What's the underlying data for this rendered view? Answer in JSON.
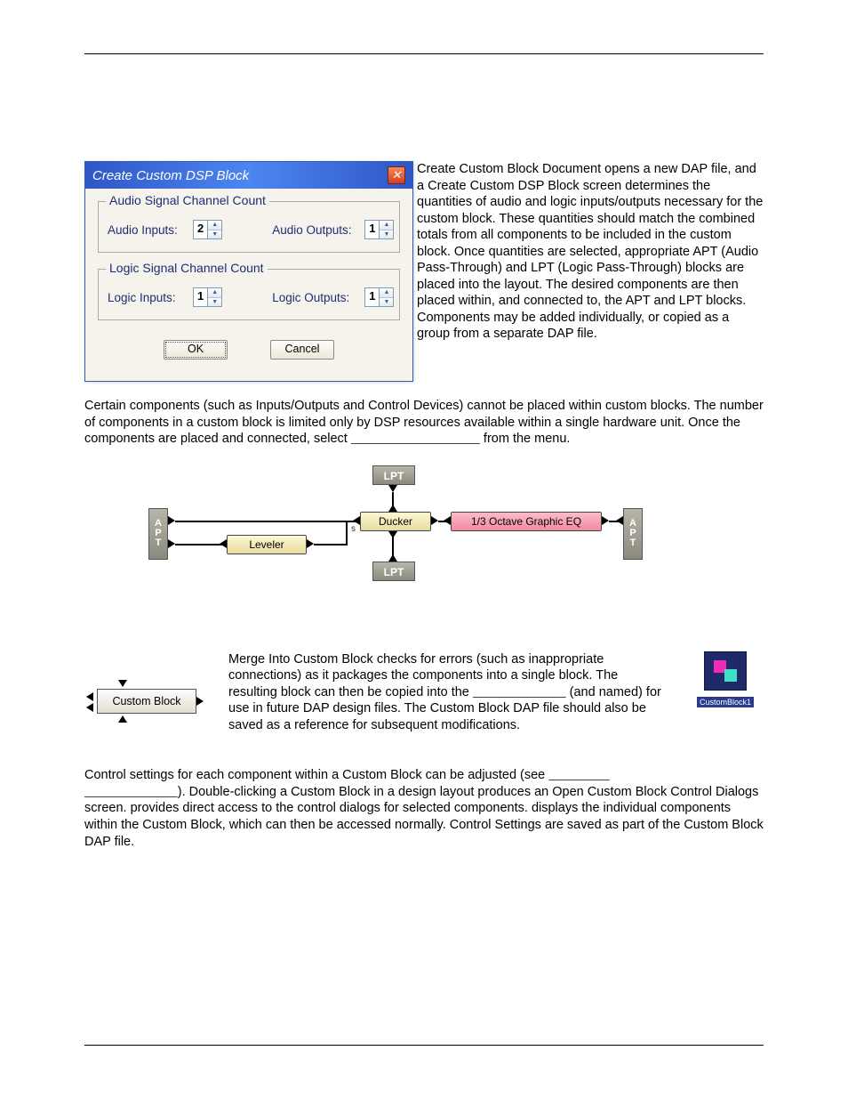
{
  "dialog": {
    "title": "Create Custom DSP Block",
    "close": "✕",
    "audio_legend": "Audio Signal Channel Count",
    "logic_legend": "Logic Signal Channel Count",
    "audio_inputs_label": "Audio Inputs:",
    "audio_inputs_value": "2",
    "audio_outputs_label": "Audio Outputs:",
    "audio_outputs_value": "1",
    "logic_inputs_label": "Logic Inputs:",
    "logic_inputs_value": "1",
    "logic_outputs_label": "Logic Outputs:",
    "logic_outputs_value": "1",
    "ok": "OK",
    "cancel": "Cancel"
  },
  "para1": "Create Custom Block Document opens a new DAP file, and a Create Custom DSP Block screen determines the quantities of audio and logic inputs/outputs necessary for the custom block. These quantities should match the combined totals from all components to be included in the custom block. Once quantities are selected, appropriate APT (Audio Pass-Through) and LPT (Logic Pass-Through) blocks are placed into the layout. The desired components are then placed within, and connected to, the APT and LPT blocks. Components may be added individually, or copied as a group from a separate DAP file.",
  "para2a": "Certain components (such as Inputs/Outputs and Control Devices) cannot be placed within custom blocks. The number of components in a custom block is limited only by DSP resources available within a single hardware unit. Once the components are placed and connected, select ",
  "para2b": " from the menu.",
  "diagram": {
    "lpt": "LPT",
    "apt": "A\nP\nT",
    "leveler": "Leveler",
    "ducker": "Ducker",
    "eq": "1/3 Octave Graphic EQ",
    "s": "s"
  },
  "custom_block_label": "Custom Block",
  "para3a": "Merge Into Custom Block checks for errors (such as inappropriate connections) as it packages the components into a single block. The resulting block can then be copied into the ",
  "para3b": " (and named) for use in future DAP design files. The Custom Block DAP file should also be saved as a reference for subsequent modifications.",
  "icon_caption": "CustomBlock1",
  "para4a": "Control settings for each component within a Custom Block can be adjusted (see ",
  "para4b": "). Double-clicking a Custom Block in a design layout produces an Open Custom Block Control Dialogs screen. ",
  "para4_bold1": "",
  "para4c": " provides direct access to the control dialogs for selected components. ",
  "para4_bold2": "",
  "para4d": " displays the individual components within the Custom Block, which can then be accessed normally. Control Settings are saved as part of the Custom Block DAP file.",
  "blank_long": "                                    ",
  "blank_med": "                          ",
  "blank_short": "                 "
}
